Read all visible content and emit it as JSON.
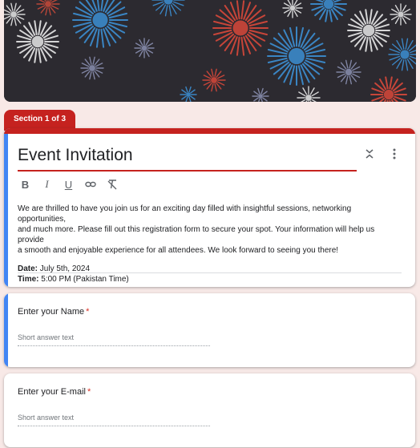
{
  "banner": {
    "description_icon": "fireworks-banner"
  },
  "section": {
    "label": "Section 1 of 3"
  },
  "form": {
    "title": "Event Invitation",
    "description_lines": [
      "We are thrilled to have you join us for an exciting day filled with insightful sessions, networking opportunities,",
      "and much more. Please fill out this registration form to secure your spot. Your information will help us provide",
      "a smooth and enjoyable experience for all attendees. We look forward to seeing you there!"
    ],
    "date_label": "Date:",
    "date_value": " July 5th, 2024",
    "time_label": "Time:",
    "time_value": " 5:00 PM (Pakistan Time)"
  },
  "toolbar": {
    "icons": [
      "bold-icon",
      "italic-icon",
      "underline-icon",
      "link-icon",
      "clear-format-icon"
    ],
    "actions": [
      "collapse-icon",
      "more-vert-icon"
    ]
  },
  "questions": [
    {
      "label": "Enter your Name",
      "required": "*",
      "placeholder": "Short answer text"
    },
    {
      "label": "Enter your E-mail",
      "required": "*",
      "placeholder": "Short answer text"
    }
  ],
  "colors": {
    "accent": "#c5221f",
    "active": "#4285f4",
    "background": "#f8e9e7"
  }
}
